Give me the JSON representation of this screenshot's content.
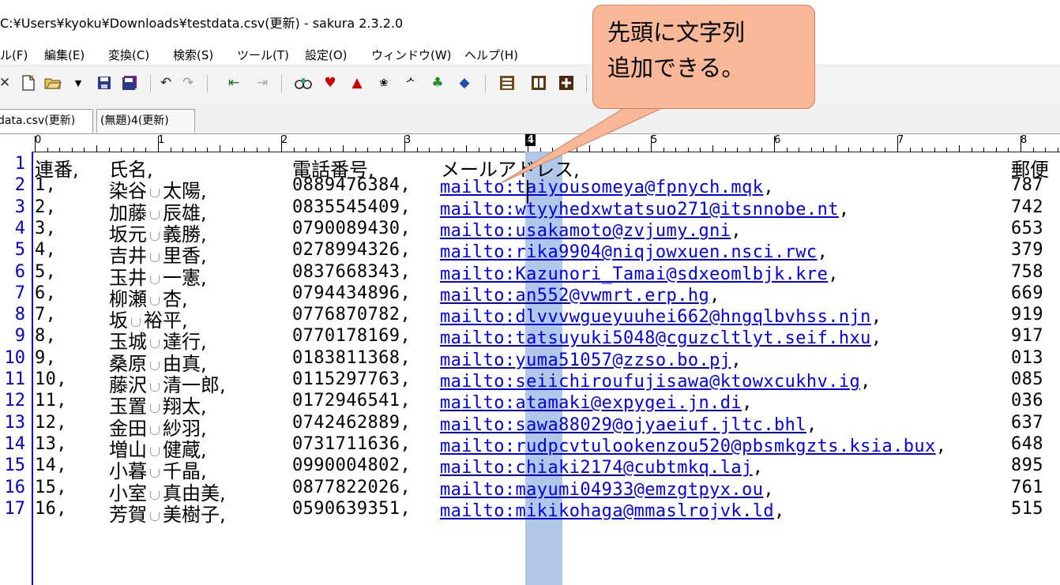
{
  "window": {
    "title": "C:¥Users¥kyoku¥Downloads¥testdata.csv(更新) - sakura 2.3.2.0"
  },
  "menu": [
    "ル(F)",
    "編集(E)",
    "変換(C)",
    "検索(S)",
    "ツール(T)",
    "設定(O)",
    "ウィンドウ(W)",
    "ヘルプ(H)"
  ],
  "toolbar_icons": [
    "close-icon",
    "new-file-icon",
    "open-folder-icon",
    "dropdown-icon",
    "save-icon",
    "save-all-icon",
    "undo-icon",
    "redo-icon",
    "jump-back-icon",
    "jump-forward-icon",
    "search-icon",
    "search-next-icon",
    "search-prev-icon",
    "replace-icon",
    "grep-icon",
    "bookmark-icon",
    "tag-jump-icon",
    "outline-icon",
    "compare-icon",
    "settings-icon"
  ],
  "tabs": [
    {
      "label": "data.csv(更新)"
    },
    {
      "label": "(無題)4(更新)"
    }
  ],
  "ruler": {
    "labels": [
      "0",
      "1",
      "2",
      "3",
      "4",
      "5",
      "6",
      "7",
      "8"
    ],
    "active": "4"
  },
  "callout": {
    "line1": "先頭に文字列",
    "line2": "追加できる。"
  },
  "rows": [
    {
      "ln": "1",
      "c1": "連番,",
      "c2a": "氏名,",
      "c2b": "",
      "c3": "電話番号,",
      "c4": "メールアドレス,",
      "c5": "郵便"
    },
    {
      "ln": "2",
      "c1": "1,",
      "c2a": "染谷",
      "c2b": "太陽,",
      "c3": "0889476384,",
      "c4": "mailto:taiyousomeya@fpnych.mqk",
      "c5": "787"
    },
    {
      "ln": "3",
      "c1": "2,",
      "c2a": "加藤",
      "c2b": "辰雄,",
      "c3": "0835545409,",
      "c4": "mailto:wtyyhedxwtatsuo271@itsnnobe.nt",
      "c5": "742"
    },
    {
      "ln": "4",
      "c1": "3,",
      "c2a": "坂元",
      "c2b": "義勝,",
      "c3": "0790089430,",
      "c4": "mailto:usakamoto@zvjumy.gni",
      "c5": "653"
    },
    {
      "ln": "5",
      "c1": "4,",
      "c2a": "吉井",
      "c2b": "里香,",
      "c3": "0278994326,",
      "c4": "mailto:rika9904@niqjowxuen.nsci.rwc",
      "c5": "379"
    },
    {
      "ln": "6",
      "c1": "5,",
      "c2a": "玉井",
      "c2b": "一憲,",
      "c3": "0837668343,",
      "c4": "mailto:Kazunori_Tamai@sdxeomlbjk.kre",
      "c5": "758"
    },
    {
      "ln": "7",
      "c1": "6,",
      "c2a": "柳瀬",
      "c2b": "杏,",
      "c3": "0794434896,",
      "c4": "mailto:an552@vwmrt.erp.hg",
      "c5": "669"
    },
    {
      "ln": "8",
      "c1": "7,",
      "c2a": "坂",
      "c2b": "裕平,",
      "c3": "0776870782,",
      "c4": "mailto:dlvvvwgueyuuhei662@hngqlbvhss.njn",
      "c5": "919"
    },
    {
      "ln": "9",
      "c1": "8,",
      "c2a": "玉城",
      "c2b": "達行,",
      "c3": "0770178169,",
      "c4": "mailto:tatsuyuki5048@cguzcltlyt.seif.hxu",
      "c5": "917"
    },
    {
      "ln": "10",
      "c1": "9,",
      "c2a": "桑原",
      "c2b": "由真,",
      "c3": "0183811368,",
      "c4": "mailto:yuma51057@zzso.bo.pj",
      "c5": "013"
    },
    {
      "ln": "11",
      "c1": "10,",
      "c2a": "藤沢",
      "c2b": "清一郎,",
      "c3": "0115297763,",
      "c4": "mailto:seiichiroufujisawa@ktowxcukhv.ig",
      "c5": "085"
    },
    {
      "ln": "12",
      "c1": "11,",
      "c2a": "玉置",
      "c2b": "翔太,",
      "c3": "0172946541,",
      "c4": "mailto:atamaki@expygei.jn.di",
      "c5": "036"
    },
    {
      "ln": "13",
      "c1": "12,",
      "c2a": "金田",
      "c2b": "紗羽,",
      "c3": "0742462889,",
      "c4": "mailto:sawa88029@ojyaeiuf.jltc.bhl",
      "c5": "637"
    },
    {
      "ln": "14",
      "c1": "13,",
      "c2a": "増山",
      "c2b": "健蔵,",
      "c3": "0731711636,",
      "c4": "mailto:rudpcvtulookenzou520@pbsmkgzts.ksia.bux",
      "c5": "648"
    },
    {
      "ln": "15",
      "c1": "14,",
      "c2a": "小暮",
      "c2b": "千晶,",
      "c3": "0990004802,",
      "c4": "mailto:chiaki2174@cubtmkq.laj",
      "c5": "895"
    },
    {
      "ln": "16",
      "c1": "15,",
      "c2a": "小室",
      "c2b": "真由美,",
      "c3": "0877822026,",
      "c4": "mailto:mayumi04933@emzgtpyx.ou",
      "c5": "761"
    },
    {
      "ln": "17",
      "c1": "16,",
      "c2a": "芳賀",
      "c2b": "美樹子,",
      "c3": "0590639351,",
      "c4": "mailto:mikikohaga@mmaslrojvk.ld",
      "c5": "515"
    }
  ]
}
